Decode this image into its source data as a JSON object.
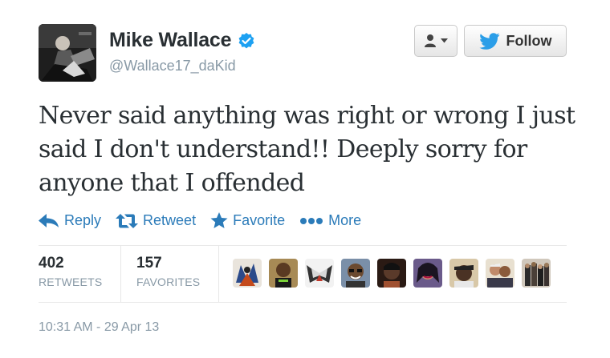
{
  "user": {
    "display_name": "Mike Wallace",
    "handle": "@Wallace17_daKid",
    "verified_icon": "verified-badge-icon",
    "avatar_icon": "user-avatar"
  },
  "header": {
    "user_menu_icon": "person-icon",
    "follow_label": "Follow",
    "follow_icon": "twitter-bird-icon"
  },
  "tweet": {
    "text_line1": "Never said anything was right or wrong I just",
    "text_line2": "said I don't understand!! Deeply sorry for",
    "text_line3": "anyone that I offended"
  },
  "actions": [
    {
      "label": "Reply",
      "icon": "reply-arrow-icon"
    },
    {
      "label": "Retweet",
      "icon": "retweet-icon"
    },
    {
      "label": "Favorite",
      "icon": "star-icon"
    },
    {
      "label": "More",
      "icon": "dots-icon"
    }
  ],
  "stats": {
    "retweets_count": "402",
    "retweets_label": "RETWEETS",
    "favorites_count": "157",
    "favorites_label": "FAVORITES"
  },
  "favoriters": [
    {
      "name": "favoriter-1"
    },
    {
      "name": "favoriter-2"
    },
    {
      "name": "favoriter-3"
    },
    {
      "name": "favoriter-4"
    },
    {
      "name": "favoriter-5"
    },
    {
      "name": "favoriter-6"
    },
    {
      "name": "favoriter-7"
    },
    {
      "name": "favoriter-8"
    },
    {
      "name": "favoriter-9"
    }
  ],
  "meta": {
    "timestamp": "10:31 AM - 29 Apr 13"
  },
  "colors": {
    "link_blue": "#2b7bb9",
    "verified_blue": "#1da1f2",
    "muted_gray": "#8899a6",
    "text_dark": "#292f33"
  }
}
